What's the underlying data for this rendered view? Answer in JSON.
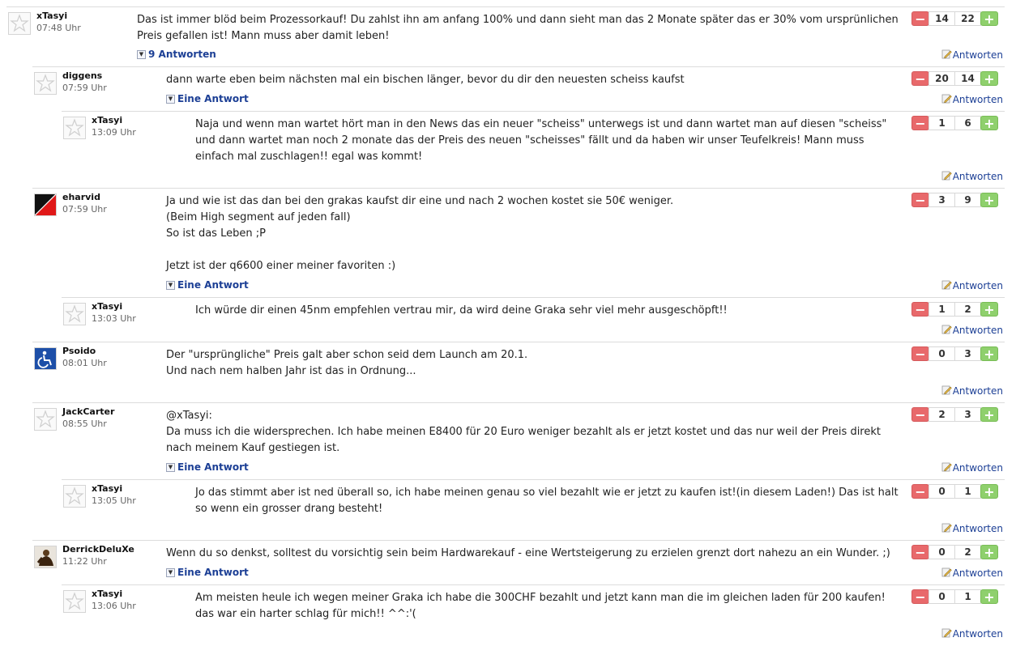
{
  "reply_label": "Antworten",
  "comments": [
    {
      "author": "xTasyi",
      "time": "07:48 Uhr",
      "level": 0,
      "avatar": "default",
      "text": "Das ist immer blöd beim Prozessorkauf! Du zahlst ihn am anfang 100% und dann sieht man das 2 Monate später das er 30% vom ursprünlichen Preis gefallen ist! Mann muss aber damit leben!",
      "votes_down": "14",
      "votes_up": "22",
      "replies_label": "9 Antworten"
    },
    {
      "author": "diggens",
      "time": "07:59 Uhr",
      "level": 1,
      "avatar": "default",
      "text": "dann warte eben beim nächsten mal ein bischen länger, bevor du dir den neuesten scheiss kaufst",
      "votes_down": "20",
      "votes_up": "14",
      "replies_label": "Eine Antwort"
    },
    {
      "author": "xTasyi",
      "time": "13:09 Uhr",
      "level": 2,
      "avatar": "default",
      "text": "Naja und wenn man wartet hört man in den News das ein neuer \"scheiss\" unterwegs ist und dann wartet man auf diesen \"scheiss\" und dann wartet man noch 2 monate das der Preis des neuen \"scheisses\" fällt und da haben wir unser Teufelkreis! Mann muss einfach mal zuschlagen!! egal was kommt!",
      "votes_down": "1",
      "votes_up": "6",
      "replies_label": ""
    },
    {
      "author": "eharvid",
      "time": "07:59 Uhr",
      "level": 1,
      "avatar": "red-black",
      "text": "Ja und wie ist das dan bei den grakas kaufst dir eine und nach 2 wochen kostet sie 50€ weniger.\n(Beim High segment auf jeden fall)\nSo ist das Leben ;P\n\nJetzt ist der q6600 einer meiner favoriten :)",
      "votes_down": "3",
      "votes_up": "9",
      "replies_label": "Eine Antwort"
    },
    {
      "author": "xTasyi",
      "time": "13:03 Uhr",
      "level": 2,
      "avatar": "default",
      "text": "Ich würde dir einen 45nm empfehlen vertrau mir, da wird deine Graka sehr viel mehr ausgeschöpft!!",
      "votes_down": "1",
      "votes_up": "2",
      "replies_label": ""
    },
    {
      "author": "Psoido",
      "time": "08:01 Uhr",
      "level": 1,
      "avatar": "wheelchair",
      "text": "Der \"ursprüngliche\" Preis galt aber schon seid dem Launch am 20.1.\nUnd nach nem halben Jahr ist das in Ordnung...",
      "votes_down": "0",
      "votes_up": "3",
      "replies_label": ""
    },
    {
      "author": "JackCarter",
      "time": "08:55 Uhr",
      "level": 1,
      "avatar": "default",
      "text": "@xTasyi:\nDa muss ich die widersprechen. Ich habe meinen E8400 für 20 Euro weniger bezahlt als er jetzt kostet und das nur weil der Preis direkt nach meinem Kauf gestiegen ist.",
      "votes_down": "2",
      "votes_up": "3",
      "replies_label": "Eine Antwort"
    },
    {
      "author": "xTasyi",
      "time": "13:05 Uhr",
      "level": 2,
      "avatar": "default",
      "text": "Jo das stimmt aber ist ned überall so, ich habe meinen genau so viel bezahlt wie er jetzt zu kaufen ist!(in diesem Laden!) Das ist halt so wenn ein grosser drang besteht!",
      "votes_down": "0",
      "votes_up": "1",
      "replies_label": ""
    },
    {
      "author": "DerrickDeluXe",
      "time": "11:22 Uhr",
      "level": 1,
      "avatar": "photo",
      "text": "Wenn du so denkst, solltest du vorsichtig sein beim Hardwarekauf - eine Wertsteigerung zu erzielen grenzt dort nahezu an ein Wunder. ;)",
      "votes_down": "0",
      "votes_up": "2",
      "replies_label": "Eine Antwort"
    },
    {
      "author": "xTasyi",
      "time": "13:06 Uhr",
      "level": 2,
      "avatar": "default",
      "text": "Am meisten heule ich wegen meiner Graka ich habe die 300CHF bezahlt und jetzt kann man die im gleichen laden für 200 kaufen! das war ein harter schlag für mich!! ^^:'(",
      "votes_down": "0",
      "votes_up": "1",
      "replies_label": ""
    }
  ]
}
